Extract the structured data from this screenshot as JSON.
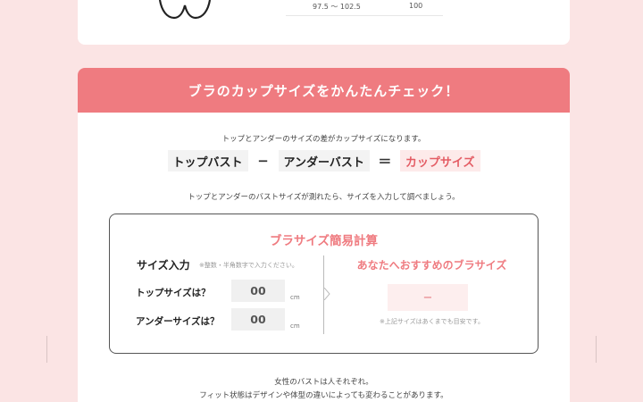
{
  "top_table": {
    "range": "97.5 ～ 102.5",
    "value": "100"
  },
  "checker": {
    "header": "ブラのカップサイズをかんたんチェック！",
    "intro": "トップとアンダーのサイズの差がカップサイズになります。",
    "formula": {
      "top": "トップバスト",
      "minus": "−",
      "under": "アンダーバスト",
      "equals": "＝",
      "cup": "カップサイズ"
    },
    "instruction": "トップとアンダーのバストサイズが測れたら、サイズを入力して調べましょう。",
    "calculator": {
      "title": "ブラサイズ簡易計算",
      "size_input_label": "サイズ入力",
      "size_input_note": "※整数・半角数字で入力ください。",
      "top_label": "トップサイズは？",
      "top_value": "00",
      "under_label": "アンダーサイズは？",
      "under_value": "00",
      "unit": "cm",
      "recommend_title": "あなたへおすすめのブラサイズ",
      "result": "−",
      "recommend_note": "※上記サイズはあくまでも目安です。"
    },
    "outro_line1": "女性のバストは人それぞれ。",
    "outro_line2": "フィット状態はデザインや体型の違いによっても変わることがあります。"
  },
  "colors": {
    "accent": "#ef7b80",
    "background": "#fbe4e4"
  }
}
